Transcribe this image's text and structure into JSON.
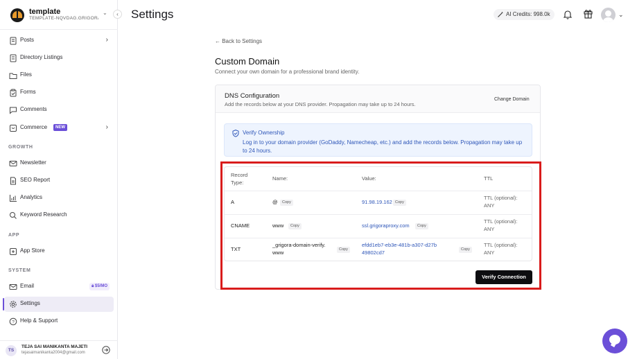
{
  "workspace": {
    "name": "template",
    "subdomain": "TEMPLATE-NQVDAG.GRIGORA.CO"
  },
  "sidebar": {
    "items_top": [
      {
        "label": "Posts",
        "icon": "posts-icon"
      },
      {
        "label": "Directory Listings",
        "icon": "directory-icon"
      },
      {
        "label": "Files",
        "icon": "folder-icon"
      },
      {
        "label": "Forms",
        "icon": "clipboard-icon"
      },
      {
        "label": "Comments",
        "icon": "comment-icon"
      },
      {
        "label": "Commerce",
        "icon": "cart-icon",
        "badge": "NEW"
      }
    ],
    "section_growth": "GROWTH",
    "items_growth": [
      {
        "label": "Newsletter",
        "icon": "mail-icon"
      },
      {
        "label": "SEO Report",
        "icon": "document-icon"
      },
      {
        "label": "Analytics",
        "icon": "analytics-icon"
      },
      {
        "label": "Keyword Research",
        "icon": "search-icon"
      }
    ],
    "section_app": "APP",
    "items_app": [
      {
        "label": "App Store",
        "icon": "app-store-icon"
      }
    ],
    "section_system": "SYSTEM",
    "items_system": [
      {
        "label": "Email",
        "icon": "mail-icon",
        "badge": "$5/MO"
      },
      {
        "label": "Settings",
        "icon": "gear-icon",
        "active": true
      },
      {
        "label": "Help & Support",
        "icon": "help-icon"
      }
    ]
  },
  "user": {
    "initials": "TS",
    "name": "TEJA SAI MANIKANTA MAJETI",
    "email": "tejasaimanikanta2004@gmail.com"
  },
  "header": {
    "title": "Settings",
    "credits": "AI Credits: 998.0k"
  },
  "main": {
    "back_link": "← Back to Settings",
    "title": "Custom Domain",
    "subtitle": "Connect your own domain for a professional brand identity.",
    "dns": {
      "title": "DNS Configuration",
      "subtitle": "Add the records below at your DNS provider. Propagation may take up to 24 hours.",
      "change_domain": "Change Domain"
    },
    "notice": {
      "title": "Verify Ownership",
      "text": "Log in to your domain provider (GoDaddy, Namecheap, etc.) and add the records below. Propagation may take up to 24 hours."
    },
    "table": {
      "headers": {
        "type": "Record Type:",
        "name": "Name:",
        "value": "Value:",
        "ttl": "TTL"
      },
      "copy_label": "Copy",
      "rows": [
        {
          "type": "A",
          "name": "@",
          "value": "91.98.19.162",
          "ttl": "TTL (optional): ANY"
        },
        {
          "type": "CNAME",
          "name": "www",
          "value": "ssl.grigoraproxy.com",
          "ttl": "TTL (optional): ANY"
        },
        {
          "type": "TXT",
          "name": "_grigora-domain-verify.www",
          "value": "efdd1eb7-eb3e-481b-a307-d27b49802cd7",
          "ttl": "TTL (optional): ANY"
        }
      ]
    },
    "verify_button": "Verify Connection"
  },
  "colors": {
    "accent": "#6b4fd8",
    "link": "#2e56b8",
    "highlight": "#d91c1c"
  }
}
